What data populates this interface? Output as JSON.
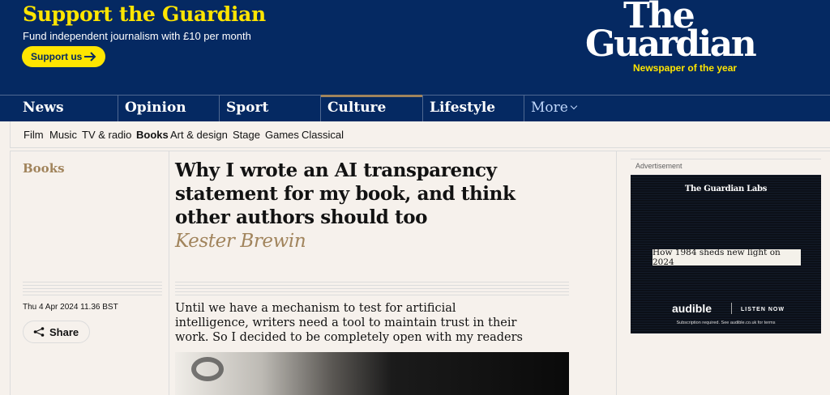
{
  "banner": {
    "title": "Support the Guardian",
    "subtitle": "Fund independent journalism with £10 per month",
    "button_label": "Support us"
  },
  "logo": {
    "line1": "The",
    "line2": "Guardian",
    "tagline": "Newspaper of the year"
  },
  "pillars": [
    {
      "label": "News"
    },
    {
      "label": "Opinion"
    },
    {
      "label": "Sport"
    },
    {
      "label": "Culture",
      "active": true
    },
    {
      "label": "Lifestyle"
    }
  ],
  "more_label": "More",
  "subnav": [
    "Film",
    "Music",
    "TV & radio",
    "Books",
    "Art & design",
    "Stage",
    "Games",
    "Classical"
  ],
  "subnav_current": "Books",
  "article": {
    "section": "Books",
    "headline": "Why I wrote an AI transparency statement for my book, and think other authors should too",
    "byline": "Kester Brewin",
    "date": "Thu 4 Apr 2024 11.36 BST",
    "share_label": "Share",
    "standfirst": "Until we have a mechanism to test for artificial intelligence, writers need a tool to maintain trust in their work. So I decided to be completely open with my readers"
  },
  "ad": {
    "label": "Advertisement",
    "brand": "The Guardian Labs",
    "headline": "How 1984 sheds new light on 2024",
    "audible": "audible",
    "listen": "LISTEN NOW",
    "small_print": "Subscription required. See audible.co.uk for terms"
  },
  "colors": {
    "brand_blue": "#052962",
    "yellow": "#ffe500",
    "culture_accent": "#a1845c",
    "background": "#f6f1ec"
  }
}
